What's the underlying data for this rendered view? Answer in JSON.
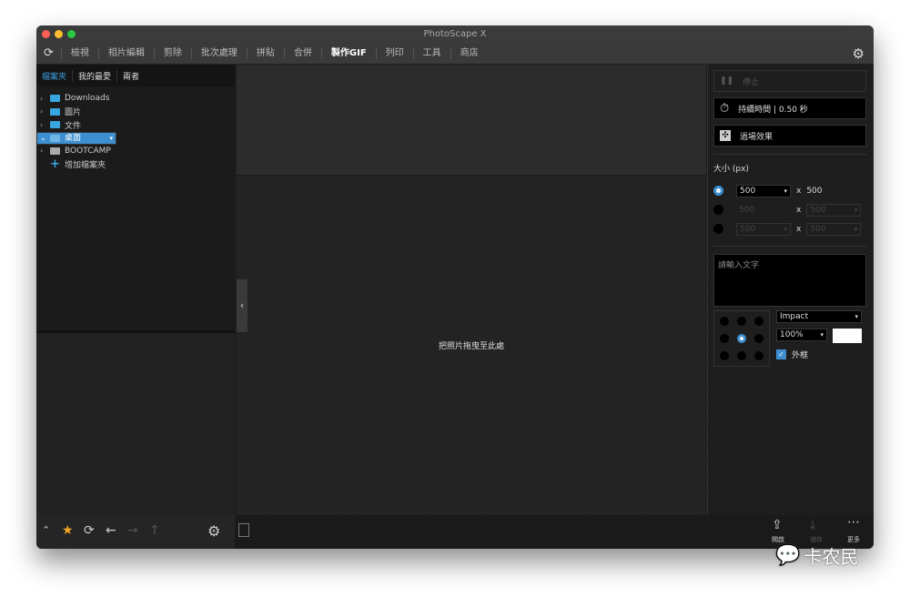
{
  "window": {
    "title": "PhotoScape X"
  },
  "toolbar": {
    "items": [
      "檢視",
      "相片編輯",
      "剪除",
      "批次處理",
      "拼貼",
      "合併",
      "製作GIF",
      "列印",
      "工具",
      "商店"
    ],
    "active": "製作GIF"
  },
  "left": {
    "tabs": [
      "檔案夾",
      "我的最愛",
      "兩者"
    ],
    "tree": [
      {
        "label": "Downloads"
      },
      {
        "label": "圖片"
      },
      {
        "label": "文件"
      },
      {
        "label": "桌面",
        "selected": true
      },
      {
        "label": "BOOTCAMP"
      }
    ],
    "add_folder": "增加檔案夾"
  },
  "center": {
    "drop_hint": "把照片拖曳至此處"
  },
  "right": {
    "stop": "停止",
    "duration": "持續時間 | 0.50 秒",
    "transition": "過場效果",
    "size_label": "大小 (px)",
    "size_rows": [
      {
        "w": "500",
        "h": "500"
      },
      {
        "w": "500",
        "h": "500"
      },
      {
        "w": "500",
        "h": "500"
      }
    ],
    "size_x": "x",
    "text_placeholder": "請輸入文字",
    "font": "Impact",
    "opacity": "100%",
    "outline": "外框",
    "text_color": "#ffffff",
    "accent": "#3d8fd0"
  },
  "bottom": {
    "open": "開啟",
    "save": "儲存",
    "more": "更多"
  },
  "watermark": "卡农民"
}
